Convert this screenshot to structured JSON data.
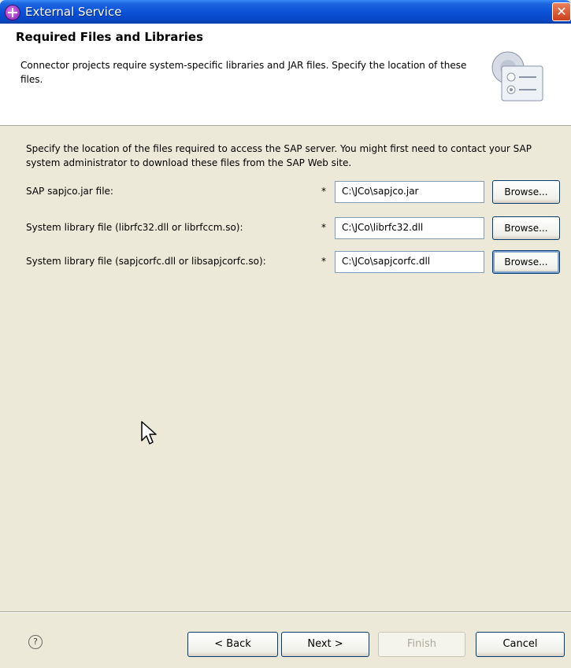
{
  "window": {
    "title": "External Service"
  },
  "header": {
    "title": "Required Files and Libraries",
    "description": "Connector projects require system-specific libraries and JAR files. Specify the location of these files."
  },
  "main": {
    "intro": "Specify the location of the files required to access the SAP server. You might first need to contact your SAP system administrator to download these files from the SAP Web site.",
    "rows": [
      {
        "label": "SAP sapjco.jar file:",
        "required": "*",
        "value": "C:\\JCo\\sapjco.jar",
        "browse": "Browse..."
      },
      {
        "label": "System library file (librfc32.dll or librfccm.so):",
        "required": "*",
        "value": "C:\\JCo\\librfc32.dll",
        "browse": "Browse..."
      },
      {
        "label": "System library file (sapjcorfc.dll or libsapjcorfc.so):",
        "required": "*",
        "value": "C:\\JCo\\sapjcorfc.dll",
        "browse": "Browse..."
      }
    ]
  },
  "footer": {
    "back": "< Back",
    "next": "Next >",
    "finish": "Finish",
    "cancel": "Cancel"
  },
  "icons": {
    "help": "help-icon",
    "close": "close-icon",
    "app": "app-icon",
    "wizard": "wizard-banner-icon"
  },
  "colors": {
    "titlebar": "#0a52d8",
    "header_bg": "#ffffff",
    "dialog_bg": "#ece9d8"
  }
}
